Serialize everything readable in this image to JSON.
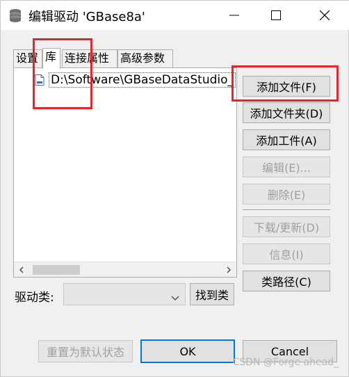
{
  "window": {
    "title": "编辑驱动 'GBase8a'",
    "app_icon": "database-icon",
    "controls": [
      "minimize-icon",
      "maximize-icon",
      "close-icon"
    ]
  },
  "tabs": [
    {
      "label": "设置",
      "active": false
    },
    {
      "label": "库",
      "active": true
    },
    {
      "label": "连接属性",
      "active": false
    },
    {
      "label": "高级参数",
      "active": false
    }
  ],
  "library": {
    "items": [
      {
        "label": "D:\\Software\\GBaseDataStudio_",
        "icon": "jar-file-icon"
      }
    ]
  },
  "buttons": {
    "add_file": "添加文件(F)",
    "add_folder": "添加文件夹(D)",
    "add_artifact": "添加工件(A)",
    "edit": "编辑(E)...",
    "delete": "删除(E)",
    "download_update": "下载/更新(D)",
    "info": "信息(I)",
    "classpath": "类路径(C)",
    "find_class": "找到类",
    "reset_default": "重置为默认状态",
    "ok": "OK",
    "cancel": "Cancel"
  },
  "driver_class": {
    "label": "驱动类:",
    "value": ""
  },
  "watermark": "CSDN @Forge ahead_",
  "colors": {
    "highlight": "#e3242b",
    "focus": "#0078d7",
    "disabled_text": "#a0a0a0"
  }
}
